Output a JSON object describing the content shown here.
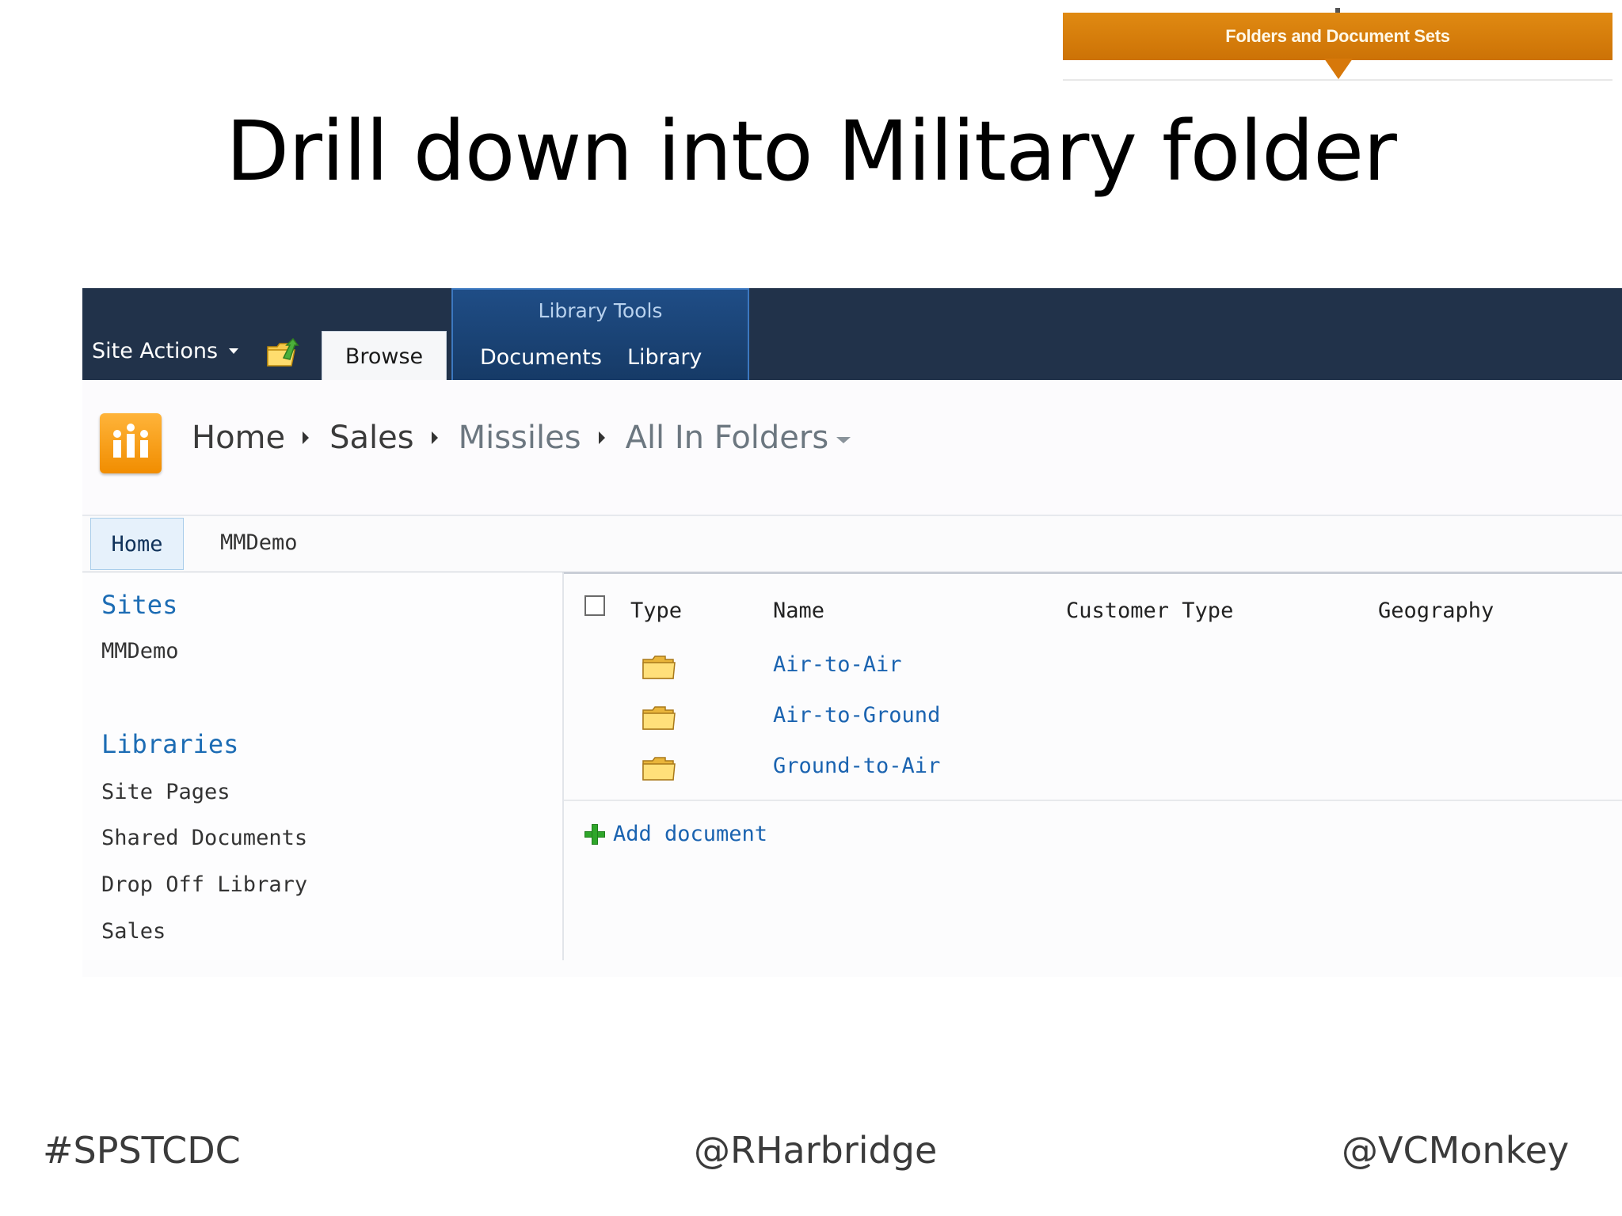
{
  "banner": {
    "label": "Folders and Document Sets"
  },
  "slide": {
    "title": "Drill down into Military folder"
  },
  "ribbon": {
    "site_actions": "Site Actions",
    "browse_tab": "Browse",
    "library_tools": "Library Tools",
    "documents_tab": "Documents",
    "library_tab": "Library"
  },
  "breadcrumb": {
    "items": [
      "Home",
      "Sales",
      "Missiles",
      "All In Folders"
    ]
  },
  "topnav": {
    "home": "Home",
    "mmdemo": "MMDemo"
  },
  "leftnav": {
    "sites_heading": "Sites",
    "sites_items": [
      "MMDemo"
    ],
    "libraries_heading": "Libraries",
    "libraries_items": [
      "Site Pages",
      "Shared Documents",
      "Drop Off Library",
      "Sales"
    ],
    "selected": "Sales"
  },
  "list": {
    "columns": [
      "Type",
      "Name",
      "Customer Type",
      "Geography"
    ],
    "rows": [
      {
        "type": "folder-icon",
        "name": "Air-to-Air"
      },
      {
        "type": "folder-icon",
        "name": "Air-to-Ground"
      },
      {
        "type": "folder-icon",
        "name": "Ground-to-Air"
      }
    ],
    "add_document": "Add document"
  },
  "footer": {
    "left": "#SPSTCDC",
    "center": "@RHarbridge",
    "right": "@VCMonkey"
  },
  "colors": {
    "ribbon": "#21324a",
    "library_tools": "#1f4d86",
    "banner": "#d7780a",
    "link": "#1a63b0"
  }
}
